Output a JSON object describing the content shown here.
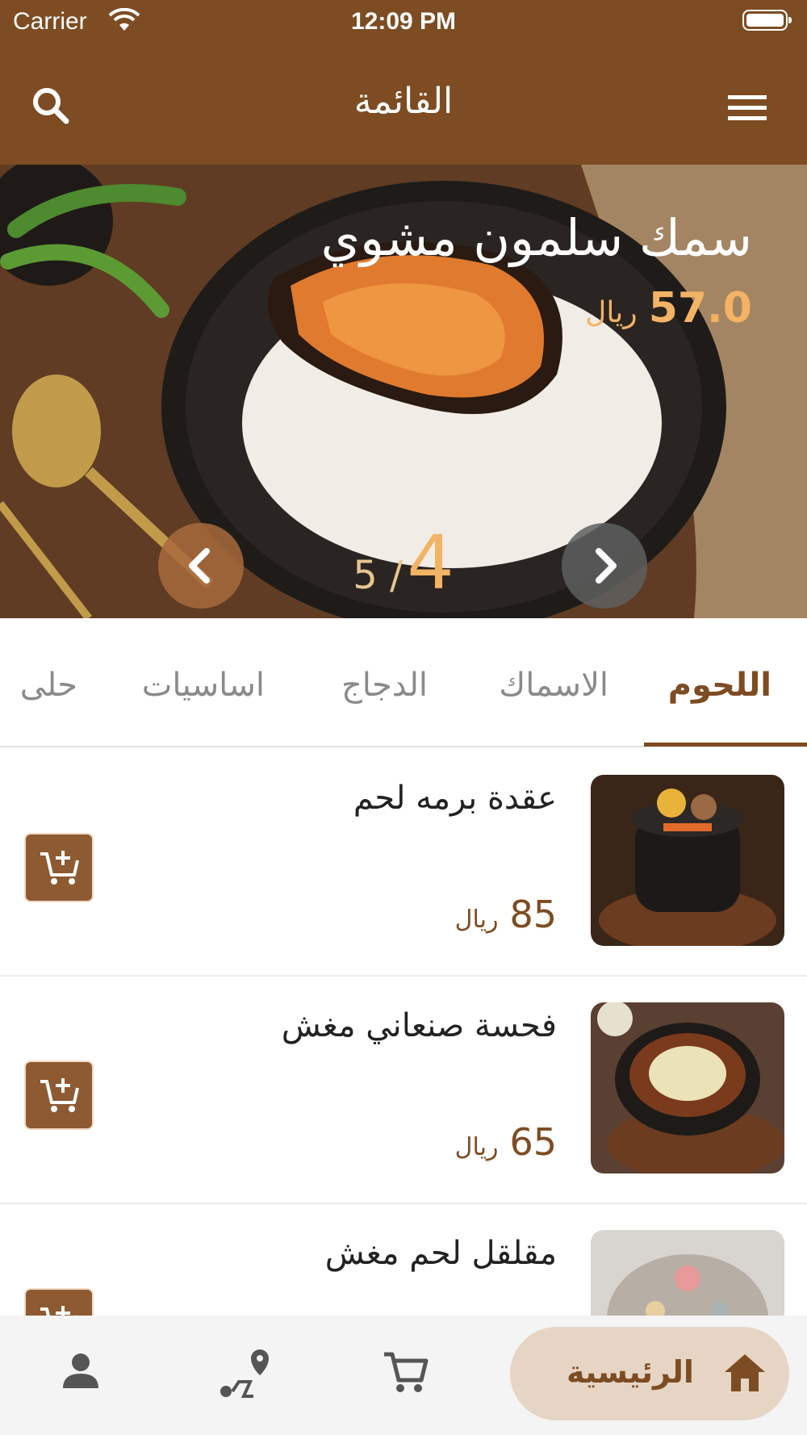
{
  "status_bar": {
    "carrier": "Carrier",
    "time": "12:09 PM"
  },
  "app_bar": {
    "title": "القائمة",
    "icons": [
      "search-icon",
      "menu-icon"
    ]
  },
  "hero": {
    "title": "سمك سلمون مشوي",
    "price": "57.0",
    "currency": "ريال",
    "slide_current": "4",
    "slide_total_text": "5 /"
  },
  "tabs": [
    {
      "label": "اللحوم",
      "active": true
    },
    {
      "label": "الاسماك",
      "active": false
    },
    {
      "label": "الدجاج",
      "active": false
    },
    {
      "label": "اساسيات",
      "active": false
    },
    {
      "label": "حلى",
      "active": false
    }
  ],
  "items": [
    {
      "name": "عقدة برمه لحم",
      "price": "85",
      "currency": "ريال"
    },
    {
      "name": "فحسة صنعاني مغش",
      "price": "65",
      "currency": "ريال"
    },
    {
      "name": "مقلقل لحم مغش",
      "price": "",
      "currency": ""
    }
  ],
  "bottom_nav": {
    "home_label": "الرئيسية",
    "icons": [
      "home-icon",
      "cart-icon",
      "location-route-icon",
      "profile-icon"
    ]
  },
  "colors": {
    "primary": "#7d4c22",
    "accent": "#f3b364",
    "home_pill": "#e6d5c5"
  }
}
